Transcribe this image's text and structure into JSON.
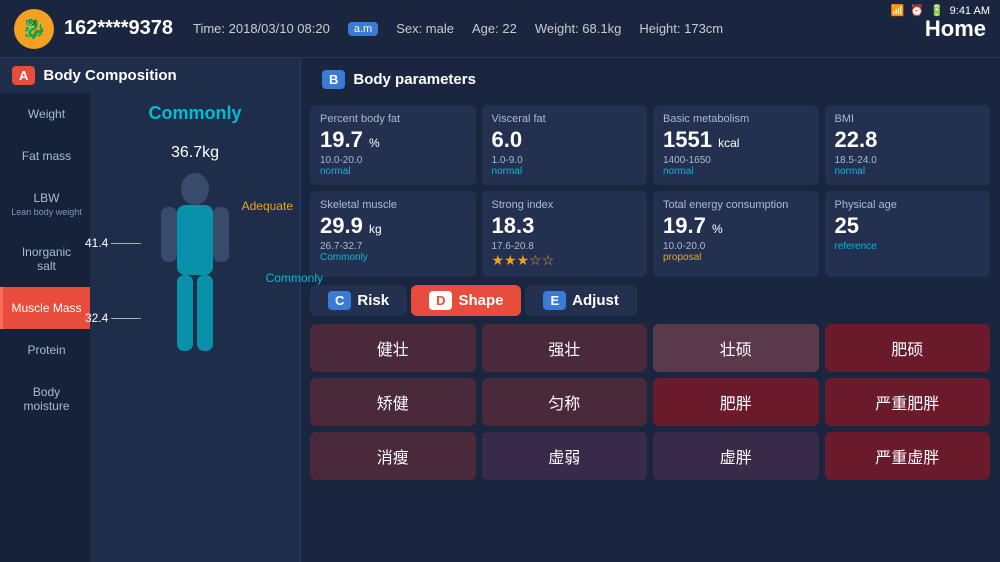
{
  "statusBar": {
    "time": "9:41 AM"
  },
  "header": {
    "phone": "162****9378",
    "time_label": "Time: 2018/03/10 08:20",
    "am": "a.m",
    "sex": "Sex: male",
    "age": "Age: 22",
    "weight": "Weight: 68.1kg",
    "height": "Height: 173cm",
    "home": "Home"
  },
  "leftPanel": {
    "section_label": "Body Composition",
    "section_badge": "A",
    "body_label": "Commonly",
    "body_value": "36.7",
    "body_unit": "kg",
    "adequate_label": "Adequate",
    "marker1_value": "41.4",
    "marker2_value": "32.4",
    "commonly_label": "Commonly",
    "nav_items": [
      {
        "label": "Weight",
        "sub": ""
      },
      {
        "label": "Fat mass",
        "sub": ""
      },
      {
        "label": "LBW",
        "sub": "Lean body weight"
      },
      {
        "label": "Inorganic salt",
        "sub": ""
      },
      {
        "label": "Muscle Mass",
        "sub": "",
        "active": true
      },
      {
        "label": "Protein",
        "sub": ""
      },
      {
        "label": "Body moisture",
        "sub": ""
      }
    ]
  },
  "bodyParams": {
    "section_label": "Body parameters",
    "section_badge": "B",
    "cards": [
      {
        "title": "Percent body fat",
        "value": "19.7",
        "unit": "%",
        "range": "10.0-20.0",
        "status": "normal"
      },
      {
        "title": "Visceral fat",
        "value": "6.0",
        "unit": "",
        "range": "1.0-9.0",
        "status": "normal"
      },
      {
        "title": "Basic metabolism",
        "value": "1551",
        "unit": "kcal",
        "range": "1400-1650",
        "status": "normal"
      },
      {
        "title": "BMI",
        "value": "22.8",
        "unit": "",
        "range": "18.5-24.0",
        "status": "normal"
      },
      {
        "title": "Skeletal muscle",
        "value": "29.9",
        "unit": "kg",
        "range": "26.7-32.7",
        "status": "Commonly"
      },
      {
        "title": "Strong index",
        "value": "18.3",
        "unit": "",
        "range": "17.6-20.8",
        "status": "stars"
      },
      {
        "title": "Total energy consumption",
        "value": "19.7",
        "unit": "%",
        "range": "10.0-20.0",
        "status": "proposal"
      },
      {
        "title": "Physical age",
        "value": "25",
        "unit": "",
        "range": "",
        "status": "reference"
      }
    ]
  },
  "tabs": {
    "items": [
      {
        "badge": "C",
        "label": "Risk"
      },
      {
        "badge": "D",
        "label": "Shape",
        "active": true
      },
      {
        "badge": "E",
        "label": "Adjust"
      }
    ]
  },
  "shapeGrid": {
    "cells": [
      "健壮",
      "强壮",
      "壮硕",
      "肥硕",
      "矫健",
      "匀称",
      "肥胖",
      "严重肥胖",
      "消瘦",
      "虚弱",
      "虚胖",
      "严重虚胖"
    ]
  }
}
